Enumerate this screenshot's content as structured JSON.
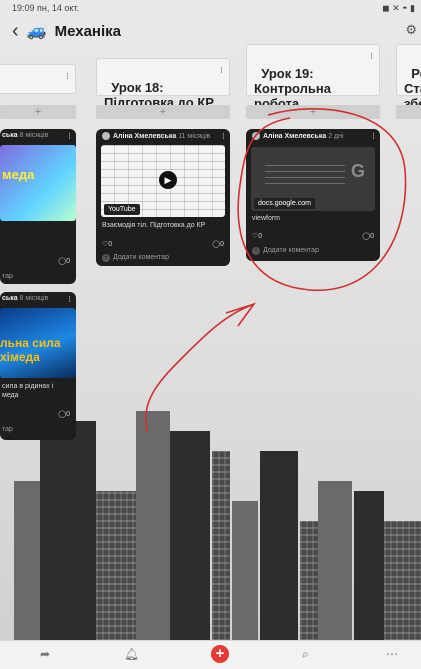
{
  "status": {
    "time_date": "19:09  пн, 14 окт.",
    "right": "◼ ✕ ◓ ▮"
  },
  "header": {
    "title": "Механіка"
  },
  "columns": [
    {
      "title": "Урок 18:\nПідготовка до КР"
    },
    {
      "title": "Урок 19:\nКонтрольна\nробота"
    },
    {
      "title": "Роз\nСта\nзбе"
    }
  ],
  "left_cards": [
    {
      "author": "ська",
      "age": "8 місяців",
      "thumb_text": "меда",
      "count": "0",
      "addc": "тар"
    },
    {
      "author": "ська",
      "age": "8 місяців",
      "thumb_text": "льна сила\nхімеда",
      "caption": "сила в рідинах і\nмеда",
      "count": "0",
      "addc": "тар"
    }
  ],
  "card18": {
    "author": "Аліна Хмелевська",
    "age": "11 місяців",
    "badge": "YouTube",
    "caption": "Взаємодія тіл. Підготовка до КР",
    "likes": "0",
    "comments": "0",
    "add_comment": "Додати коментар"
  },
  "card19": {
    "author": "Аліна Хмелевська",
    "age": "2 дні",
    "link_domain": "docs.google.com",
    "caption": "viewform",
    "likes": "0",
    "comments": "0",
    "add_comment": "Додати коментар"
  }
}
